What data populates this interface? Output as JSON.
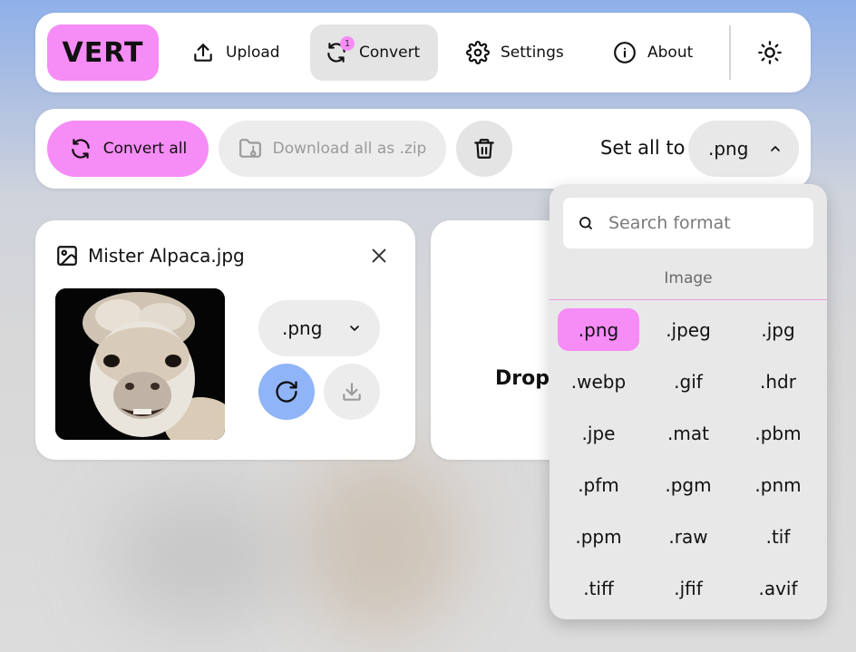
{
  "nav": {
    "logo": "VERT",
    "upload": "Upload",
    "convert": "Convert",
    "convert_badge": "1",
    "settings": "Settings",
    "about": "About"
  },
  "toolbar": {
    "convert_all": "Convert all",
    "download_zip": "Download all as .zip",
    "set_all_label": "Set all to",
    "set_all_value": ".png"
  },
  "file": {
    "name": "Mister Alpaca.jpg",
    "format": ".png"
  },
  "drop": {
    "text": "Drop"
  },
  "dropdown": {
    "search_placeholder": "Search format",
    "category": "Image",
    "selected": ".png",
    "formats": [
      ".png",
      ".jpeg",
      ".jpg",
      ".webp",
      ".gif",
      ".hdr",
      ".jpe",
      ".mat",
      ".pbm",
      ".pfm",
      ".pgm",
      ".pnm",
      ".ppm",
      ".raw",
      ".tif",
      ".tiff",
      ".jfif",
      ".avif"
    ]
  },
  "colors": {
    "accent_pink": "#f68cf6",
    "accent_blue": "#8fb4f7"
  }
}
